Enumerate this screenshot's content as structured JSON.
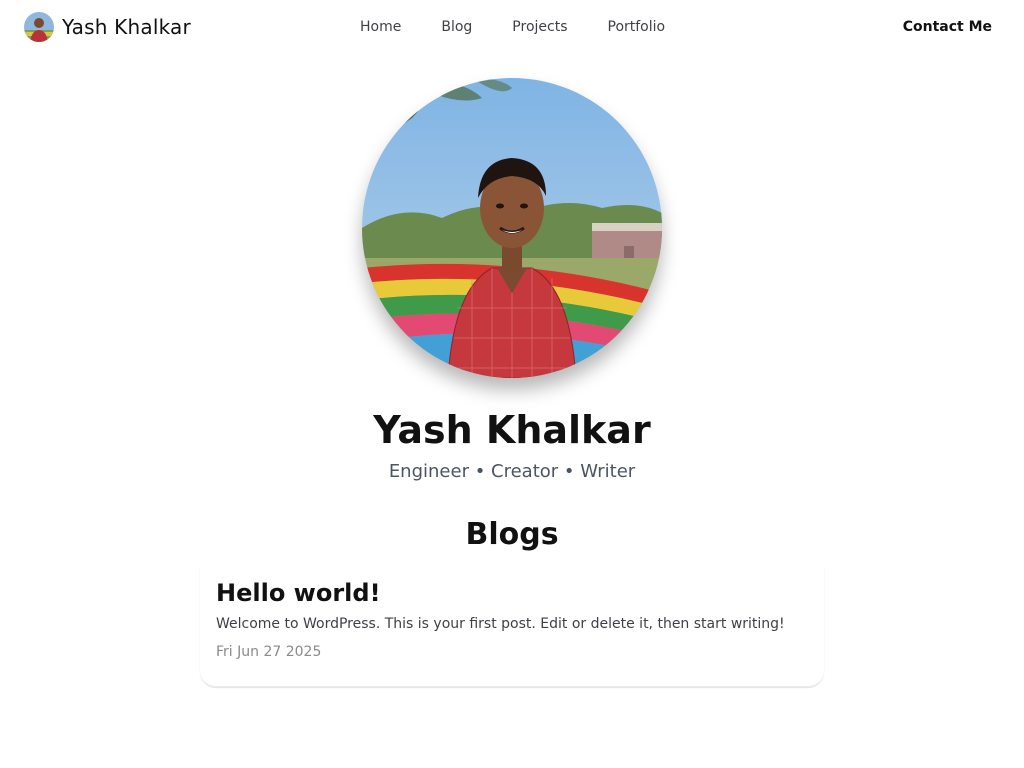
{
  "header": {
    "brand_name": "Yash Khalkar",
    "brand_avatar_icon": "avatar-photo",
    "nav": [
      {
        "label": "Home"
      },
      {
        "label": "Blog"
      },
      {
        "label": "Projects"
      },
      {
        "label": "Portfolio"
      }
    ],
    "contact_label": "Contact Me"
  },
  "hero": {
    "photo_icon": "profile-photo",
    "name": "Yash Khalkar",
    "tagline": "Engineer • Creator • Writer"
  },
  "blogs": {
    "section_title": "Blogs",
    "posts": [
      {
        "title": "Hello world!",
        "excerpt": "Welcome to WordPress. This is your first post. Edit or delete it, then start writing!",
        "date": "Fri Jun 27 2025"
      }
    ]
  },
  "colors": {
    "text": "#111111",
    "muted": "#4b5563",
    "date": "#8a8a8a",
    "background": "#ffffff"
  }
}
